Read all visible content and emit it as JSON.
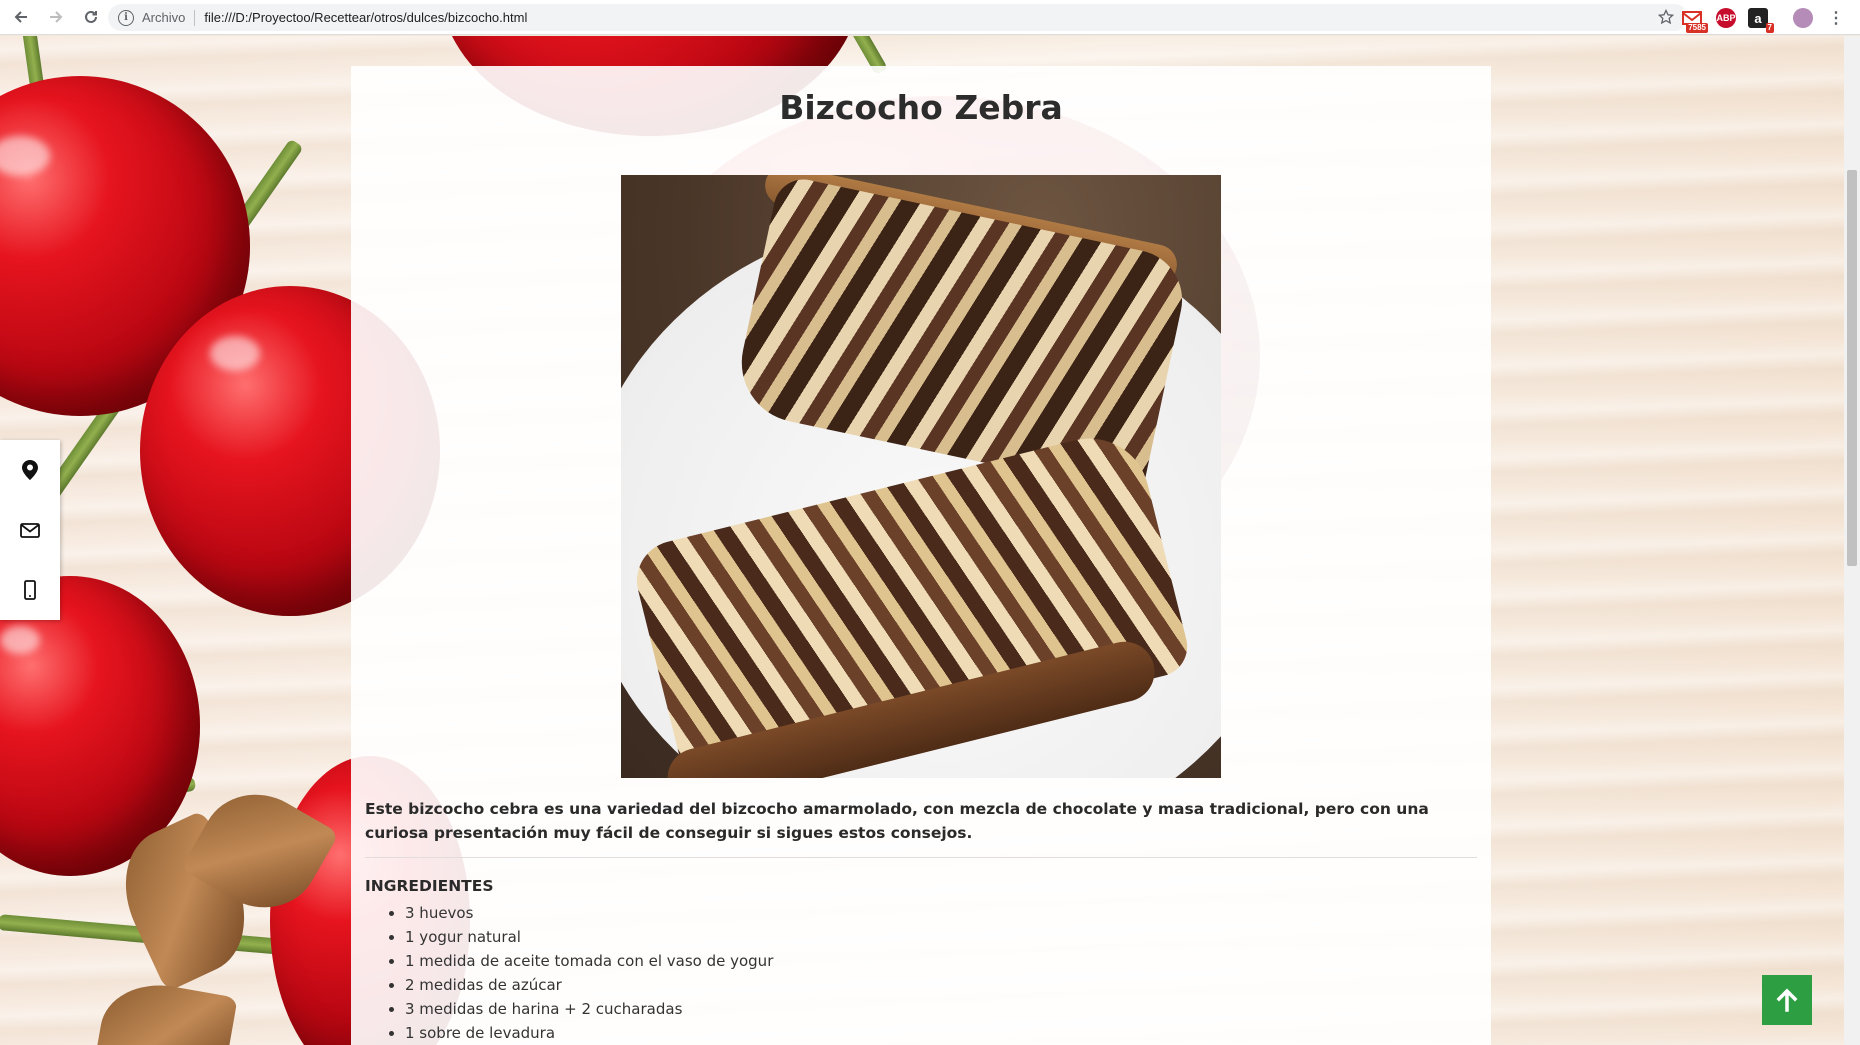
{
  "browser": {
    "scheme_label": "Archivo",
    "url": "file:///D:/Proyectoo/Recettear/otros/dulces/bizcocho.html",
    "extensions": [
      {
        "name": "gmail-extension",
        "badge": "7585",
        "color": "#d93025"
      },
      {
        "name": "adblock-extension",
        "label": "ABP",
        "color": "#c70d2c"
      },
      {
        "name": "amazon-extension",
        "label": "a",
        "badge": "7",
        "color": "#222222"
      },
      {
        "name": "profile-avatar",
        "color": "#b58bb8"
      }
    ]
  },
  "recipe": {
    "title": "Bizcocho Zebra",
    "image_alt": "Bizcocho cebra",
    "description": "Este bizcocho cebra es una variedad del bizcocho amarmolado, con mezcla de chocolate y masa tradicional, pero con una curiosa presentación muy fácil de conseguir si sigues estos consejos.",
    "ingredients_title": "INGREDIENTES",
    "ingredients": [
      "3 huevos",
      "1 yogur natural",
      "1 medida de aceite tomada con el vaso de yogur",
      "2 medidas de azúcar",
      "3 medidas de harina + 2 cucharadas",
      "1 sobre de levadura"
    ]
  },
  "side_contact": [
    "location-icon",
    "mail-icon",
    "mobile-icon"
  ],
  "colors": {
    "back_to_top": "#2e9e43",
    "card_bg": "#ffffff"
  }
}
